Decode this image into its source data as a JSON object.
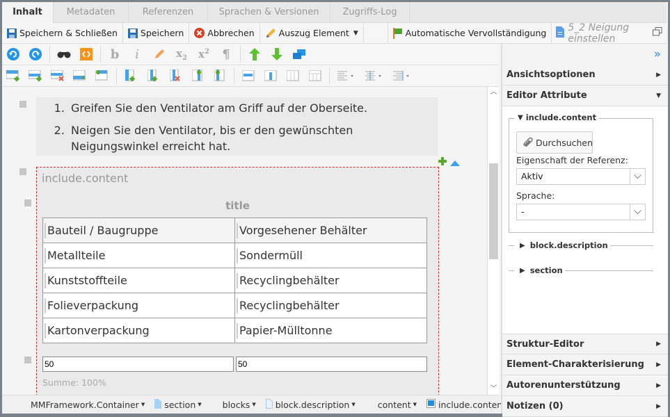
{
  "tabs": [
    {
      "label": "Inhalt",
      "active": true
    },
    {
      "label": "Metadaten",
      "active": false
    },
    {
      "label": "Referenzen",
      "active": false
    },
    {
      "label": "Sprachen & Versionen",
      "active": false
    },
    {
      "label": "Zugriffs-Log",
      "active": false
    }
  ],
  "toolbar": {
    "save_close": "Speichern & Schließen",
    "save": "Speichern",
    "cancel": "Abbrechen",
    "extract": "Auszug Element",
    "autocomplete": "Automatische Vervollständigung",
    "doc_title": "5_2 Neigung einstellen"
  },
  "document": {
    "steps": [
      "Greifen Sie den Ventilator am Griff auf der Oberseite.",
      "Neigen Sie den Ventilator, bis er den gewünschten Neigungswinkel erreicht hat."
    ],
    "include_label": "include.content",
    "table_title": "title",
    "table": {
      "header": [
        "Bauteil / Baugruppe",
        "Vorgesehener Behälter"
      ],
      "rows": [
        [
          "Metallteile",
          "Sondermüll"
        ],
        [
          "Kunststoffteile",
          "Recyclingbehälter"
        ],
        [
          "Folieverpackung",
          "Recyclingbehälter"
        ],
        [
          "Kartonverpackung",
          "Papier-Mülltonne"
        ]
      ]
    },
    "column_widths": [
      "50",
      "50"
    ],
    "sum_label": "Summe: 100%"
  },
  "breadcrumb": [
    {
      "label": "MMFramework.Container",
      "icon": "none"
    },
    {
      "label": "section",
      "icon": "section-doc-icon"
    },
    {
      "label": "blocks",
      "icon": "none"
    },
    {
      "label": "block.description",
      "icon": "block-doc-icon"
    },
    {
      "label": "content",
      "icon": "none"
    },
    {
      "label": "include.content",
      "icon": "include-icon"
    }
  ],
  "right_panel": {
    "sections": {
      "view_options": "Ansichtsoptionen",
      "editor_attributes": "Editor Attribute",
      "structure_editor": "Struktur-Editor",
      "element_char": "Element-Charakterisierung",
      "author_support": "Autorenunterstützung",
      "notes": "Notizen (0)"
    },
    "include_group": "include.content",
    "browse_label": "Durchsuchen",
    "ref_property_label": "Eigenschaft der Referenz:",
    "ref_property_value": "Aktiv",
    "language_label": "Sprache:",
    "language_value": "-",
    "subsections": [
      "block.description",
      "section"
    ]
  },
  "colors": {
    "accent_blue": "#2a8fe0",
    "dashed_red": "#d42b2b",
    "green": "#5aa829"
  }
}
